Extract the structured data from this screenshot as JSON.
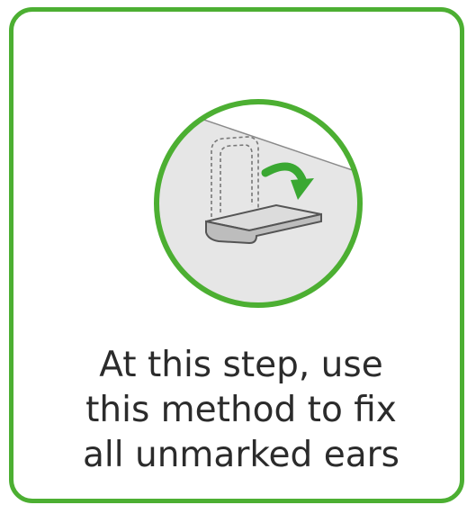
{
  "caption": {
    "line1": "At this step, use",
    "line2": "this method to fix",
    "line3": "all unmarked ears"
  },
  "illustration": {
    "icon": "fold-ear-instruction-icon",
    "accent_color": "#4caf32",
    "fill_color": "#e8e8e8",
    "line_color": "#555555"
  }
}
